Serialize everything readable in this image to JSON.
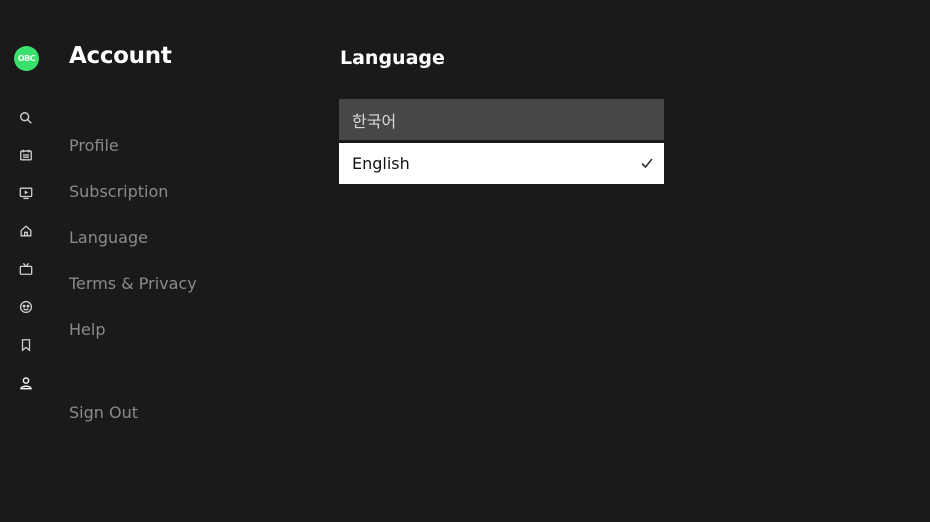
{
  "sidebar": {
    "logo_text": "OBC",
    "icons": [
      {
        "name": "search-icon"
      },
      {
        "name": "schedule-icon"
      },
      {
        "name": "video-icon"
      },
      {
        "name": "home-icon"
      },
      {
        "name": "tv-icon"
      },
      {
        "name": "kids-icon"
      },
      {
        "name": "bookmark-icon"
      },
      {
        "name": "account-icon"
      }
    ]
  },
  "account": {
    "title": "Account",
    "menu": {
      "profile": "Profile",
      "subscription": "Subscription",
      "language": "Language",
      "terms": "Terms & Privacy",
      "help": "Help",
      "sign_out": "Sign Out"
    }
  },
  "language": {
    "title": "Language",
    "options": [
      {
        "label": "한국어",
        "selected": false
      },
      {
        "label": "English",
        "selected": true
      }
    ]
  },
  "colors": {
    "background": "#1a1a1a",
    "accent": "#39e06b",
    "menu_text": "#8a8a8a",
    "option_unselected": "#474747",
    "option_selected": "#ffffff"
  }
}
